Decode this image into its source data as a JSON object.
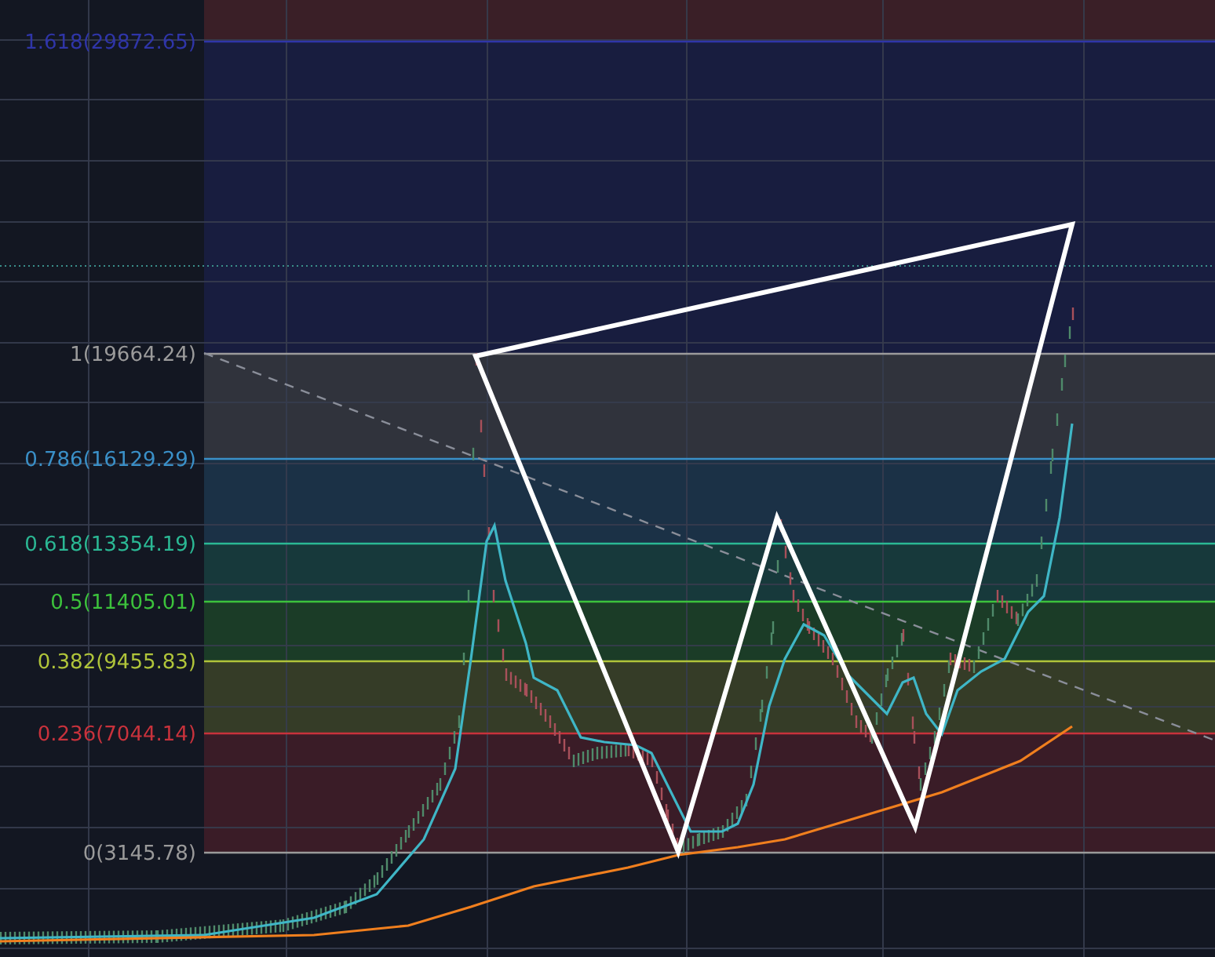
{
  "fib_levels": [
    {
      "label": "1.618(29872.65)",
      "color": "#2f35a8"
    },
    {
      "label": "1(19664.24)",
      "color": "#9b9b9b"
    },
    {
      "label": "0.786(16129.29)",
      "color": "#3a90c8"
    },
    {
      "label": "0.618(13354.19)",
      "color": "#2bb894"
    },
    {
      "label": "0.5(11405.01)",
      "color": "#3cc23c"
    },
    {
      "label": "0.382(9455.83)",
      "color": "#b0c43a"
    },
    {
      "label": "0.236(7044.14)",
      "color": "#c8323c"
    },
    {
      "label": "0(3145.78)",
      "color": "#9a9a9a"
    }
  ]
}
